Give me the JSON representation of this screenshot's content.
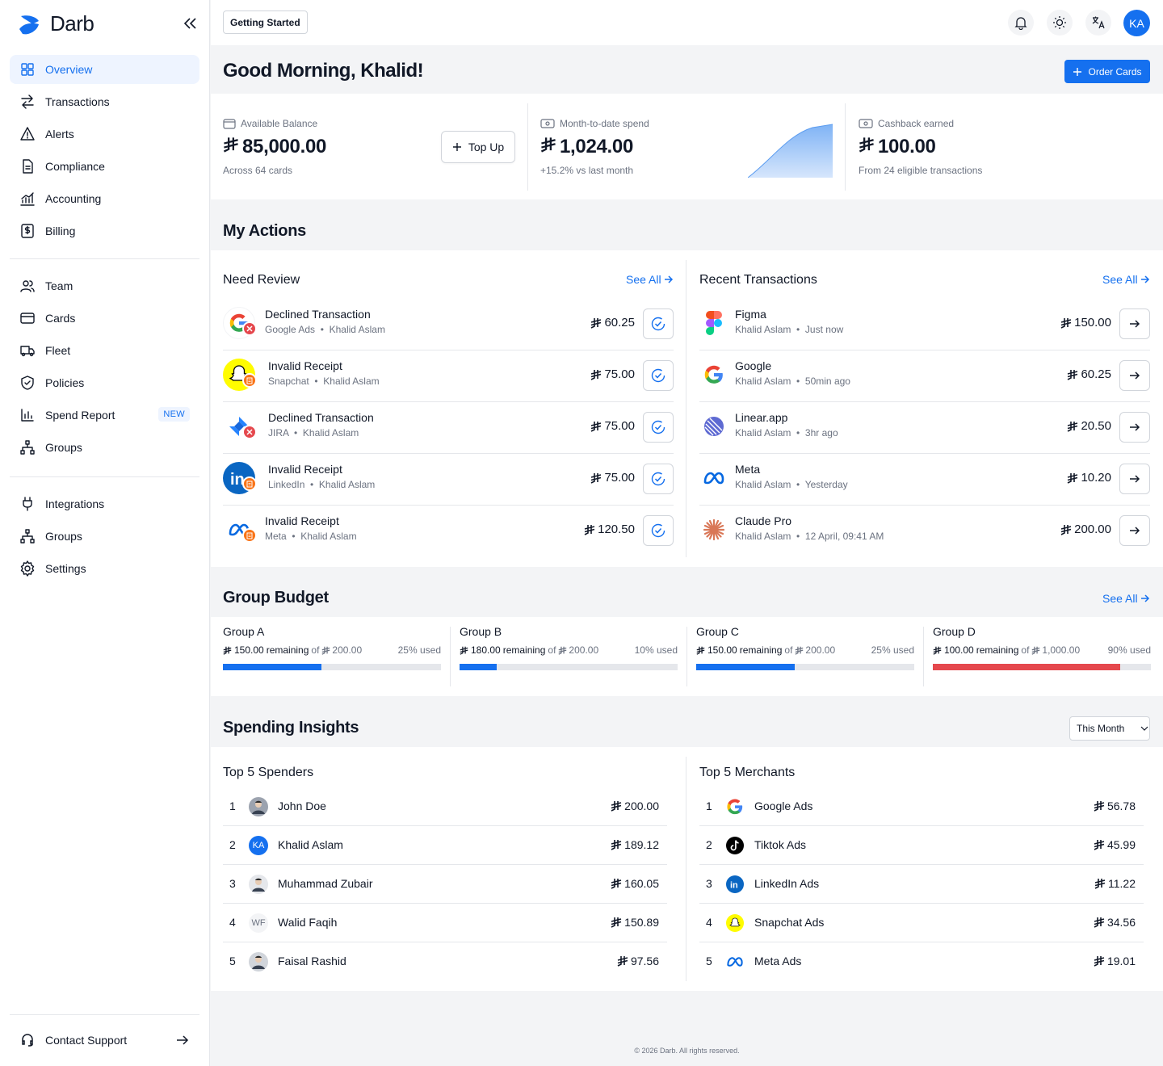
{
  "app": {
    "name": "Darb",
    "currency_symbol": "⃁"
  },
  "sidebar": {
    "primary": [
      {
        "label": "Overview",
        "icon": "grid-icon",
        "active": true
      },
      {
        "label": "Transactions",
        "icon": "arrows-icon"
      },
      {
        "label": "Alerts",
        "icon": "warning-icon"
      },
      {
        "label": "Compliance",
        "icon": "document-icon"
      },
      {
        "label": "Accounting",
        "icon": "chart-icon"
      },
      {
        "label": "Billing",
        "icon": "dollar-icon"
      }
    ],
    "secondary": [
      {
        "label": "Team",
        "icon": "users-icon"
      },
      {
        "label": "Cards",
        "icon": "card-icon"
      },
      {
        "label": "Fleet",
        "icon": "truck-icon"
      },
      {
        "label": "Policies",
        "icon": "shield-icon"
      },
      {
        "label": "Spend Report",
        "icon": "bar-chart-icon",
        "badge": "NEW"
      },
      {
        "label": "Groups",
        "icon": "hierarchy-icon"
      }
    ],
    "tertiary": [
      {
        "label": "Integrations",
        "icon": "plug-icon"
      },
      {
        "label": "Groups",
        "icon": "hierarchy-icon"
      },
      {
        "label": "Settings",
        "icon": "gear-icon"
      }
    ],
    "contact_support": "Contact Support"
  },
  "topbar": {
    "getting_started": "Getting Started",
    "avatar_initials": "KA"
  },
  "greeting": "Good Morning, Khalid!",
  "order_cards": "Order Cards",
  "stats": {
    "balance": {
      "label": "Available Balance",
      "value": "85,000.00",
      "sub": "Across 64 cards",
      "action": "Top Up"
    },
    "spend": {
      "label": "Month-to-date spend",
      "value": "1,024.00",
      "sub": "+15.2% vs last month"
    },
    "cashback": {
      "label": "Cashback earned",
      "value": "100.00",
      "sub": "From 24 eligible transactions"
    }
  },
  "my_actions": {
    "title": "My Actions",
    "need_review": {
      "title": "Need Review",
      "see_all": "See All",
      "items": [
        {
          "title": "Declined Transaction",
          "merchant": "Google Ads",
          "user": "Khalid Aslam",
          "amount": "60.25",
          "logo": "google",
          "status": "declined"
        },
        {
          "title": "Invalid Receipt",
          "merchant": "Snapchat",
          "user": "Khalid Aslam",
          "amount": "75.00",
          "logo": "snapchat",
          "status": "receipt"
        },
        {
          "title": "Declined Transaction",
          "merchant": "JIRA",
          "user": "Khalid Aslam",
          "amount": "75.00",
          "logo": "jira",
          "status": "declined"
        },
        {
          "title": "Invalid Receipt",
          "merchant": "LinkedIn",
          "user": "Khalid Aslam",
          "amount": "75.00",
          "logo": "linkedin",
          "status": "receipt"
        },
        {
          "title": "Invalid Receipt",
          "merchant": "Meta",
          "user": "Khalid Aslam",
          "amount": "120.50",
          "logo": "meta",
          "status": "receipt"
        }
      ]
    },
    "recent": {
      "title": "Recent Transactions",
      "see_all": "See All",
      "items": [
        {
          "title": "Figma",
          "user": "Khalid Aslam",
          "time": "Just now",
          "amount": "150.00",
          "logo": "figma"
        },
        {
          "title": "Google",
          "user": "Khalid Aslam",
          "time": "50min ago",
          "amount": "60.25",
          "logo": "google"
        },
        {
          "title": "Linear.app",
          "user": "Khalid Aslam",
          "time": "3hr ago",
          "amount": "20.50",
          "logo": "linear"
        },
        {
          "title": "Meta",
          "user": "Khalid Aslam",
          "time": "Yesterday",
          "amount": "10.20",
          "logo": "meta"
        },
        {
          "title": "Claude Pro",
          "user": "Khalid Aslam",
          "time": "12 April, 09:41 AM",
          "amount": "200.00",
          "logo": "claude"
        }
      ]
    }
  },
  "group_budget": {
    "title": "Group Budget",
    "see_all": "See All",
    "remaining_word": "remaining",
    "of_word": "of",
    "groups": [
      {
        "name": "Group A",
        "remaining": "150.00",
        "total": "200.00",
        "used": "25% used",
        "used_fraction": 0.45,
        "color": "#1570ef"
      },
      {
        "name": "Group B",
        "remaining": "180.00",
        "total": "200.00",
        "used": "10% used",
        "used_fraction": 0.17,
        "color": "#1570ef"
      },
      {
        "name": "Group C",
        "remaining": "150.00",
        "total": "200.00",
        "used": "25% used",
        "used_fraction": 0.45,
        "color": "#1570ef"
      },
      {
        "name": "Group D",
        "remaining": "100.00",
        "total": "1,000.00",
        "used": "90% used",
        "used_fraction": 0.86,
        "color": "#e5484d"
      }
    ]
  },
  "insights": {
    "title": "Spending Insights",
    "period": "This Month",
    "spenders": {
      "title": "Top 5 Spenders",
      "items": [
        {
          "rank": "1",
          "name": "John Doe",
          "amount": "200.00",
          "avatar": "photo",
          "initials": ""
        },
        {
          "rank": "2",
          "name": "Khalid Aslam",
          "amount": "189.12",
          "avatar": "initials-blue",
          "initials": "KA"
        },
        {
          "rank": "3",
          "name": "Muhammad Zubair",
          "amount": "160.05",
          "avatar": "photo",
          "initials": ""
        },
        {
          "rank": "4",
          "name": "Walid Faqih",
          "amount": "150.89",
          "avatar": "initials-gray",
          "initials": "WF"
        },
        {
          "rank": "5",
          "name": "Faisal Rashid",
          "amount": "97.56",
          "avatar": "photo",
          "initials": ""
        }
      ]
    },
    "merchants": {
      "title": "Top 5 Merchants",
      "items": [
        {
          "rank": "1",
          "name": "Google Ads",
          "amount": "56.78",
          "logo": "google"
        },
        {
          "rank": "2",
          "name": "Tiktok Ads",
          "amount": "45.99",
          "logo": "tiktok"
        },
        {
          "rank": "3",
          "name": "LinkedIn Ads",
          "amount": "11.22",
          "logo": "linkedin"
        },
        {
          "rank": "4",
          "name": "Snapchat Ads",
          "amount": "34.56",
          "logo": "snapchat"
        },
        {
          "rank": "5",
          "name": "Meta Ads",
          "amount": "19.01",
          "logo": "meta"
        }
      ]
    }
  },
  "footer": "© 2026 Darb. All rights reserved."
}
